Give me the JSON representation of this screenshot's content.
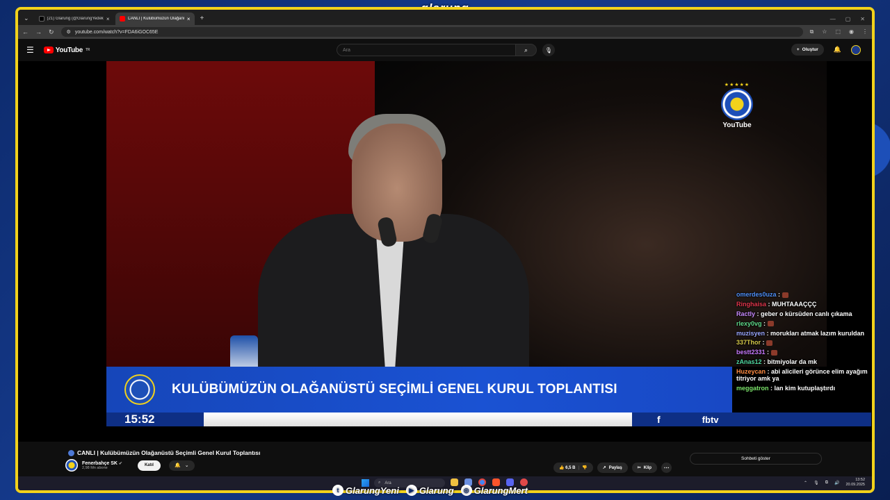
{
  "overlay": {
    "brand": "glarung",
    "socials": [
      {
        "icon": "twitter-icon",
        "handle": "GlarungYeni"
      },
      {
        "icon": "youtube-icon",
        "handle": "Glarung"
      },
      {
        "icon": "instagram-icon",
        "handle": "GlarungMert"
      }
    ]
  },
  "browser": {
    "tabs": [
      {
        "title": "(21) Glarung (@GlarungYedek) / X",
        "favicon_color": "#000000"
      },
      {
        "title": "CANLI | Kulübümüzün Olağanüstü",
        "favicon_color": "#ff0000"
      }
    ],
    "url": "youtube.com/watch?v=FDA6iGOC65E"
  },
  "youtube": {
    "logo": "YouTube",
    "region": "TR",
    "search_placeholder": "Ara",
    "create_label": "Oluştur"
  },
  "video": {
    "lower_third_title": "KULÜBÜMÜZÜN OLAĞANÜSTÜ SEÇİMLİ GENEL KURUL TOPLANTISI",
    "clock": "15:52",
    "f_label": "f",
    "fbtv_label": "fbtv",
    "watermark": "YouTube",
    "stars": "★★★★★"
  },
  "chat": {
    "messages": [
      {
        "user": "omerdes0uza",
        "color": "#4f8ff7",
        "text": "",
        "emote": true
      },
      {
        "user": "Ringhaisa",
        "color": "#e0364c",
        "text": "MUHTAAAÇÇÇ",
        "emote": false
      },
      {
        "user": "Ractly",
        "color": "#c98bff",
        "text": "geber o kürsüden canlı çıkama",
        "emote": false
      },
      {
        "user": "rlexy0vg",
        "color": "#5fd98a",
        "text": "",
        "emote": true
      },
      {
        "user": "muzisyen",
        "color": "#9aa7ff",
        "text": "morukları atmak lazım kuruldan",
        "emote": false
      },
      {
        "user": "337Thor",
        "color": "#d6c94a",
        "text": "",
        "emote": true
      },
      {
        "user": "bestt2331",
        "color": "#c97bff",
        "text": "",
        "emote": true
      },
      {
        "user": "zAnas12",
        "color": "#4fd6a0",
        "text": "bitmiyolar da mk",
        "emote": false
      },
      {
        "user": "Huzeycan",
        "color": "#ff8c42",
        "text": "abi alicileri görünce elim ayağım titriyor amk ya",
        "emote": false
      },
      {
        "user": "meggatron",
        "color": "#7be36a",
        "text": "lan kim kutuplaştırdı",
        "emote": false
      }
    ],
    "toggle_label": "Sohbeti göster"
  },
  "below": {
    "title": "CANLI | Kulübümüzün Olağanüstü Seçimli Genel Kurul Toplantısı",
    "channel_name": "Fenerbahçe SK",
    "subscribers": "2,98 Mn abone",
    "join_label": "Katıl",
    "likes": "6,5 B",
    "share_label": "Paylaş",
    "clip_label": "Klip"
  },
  "taskbar": {
    "search_placeholder": "Ara",
    "time": "13:52",
    "date": "20.09.2025"
  }
}
